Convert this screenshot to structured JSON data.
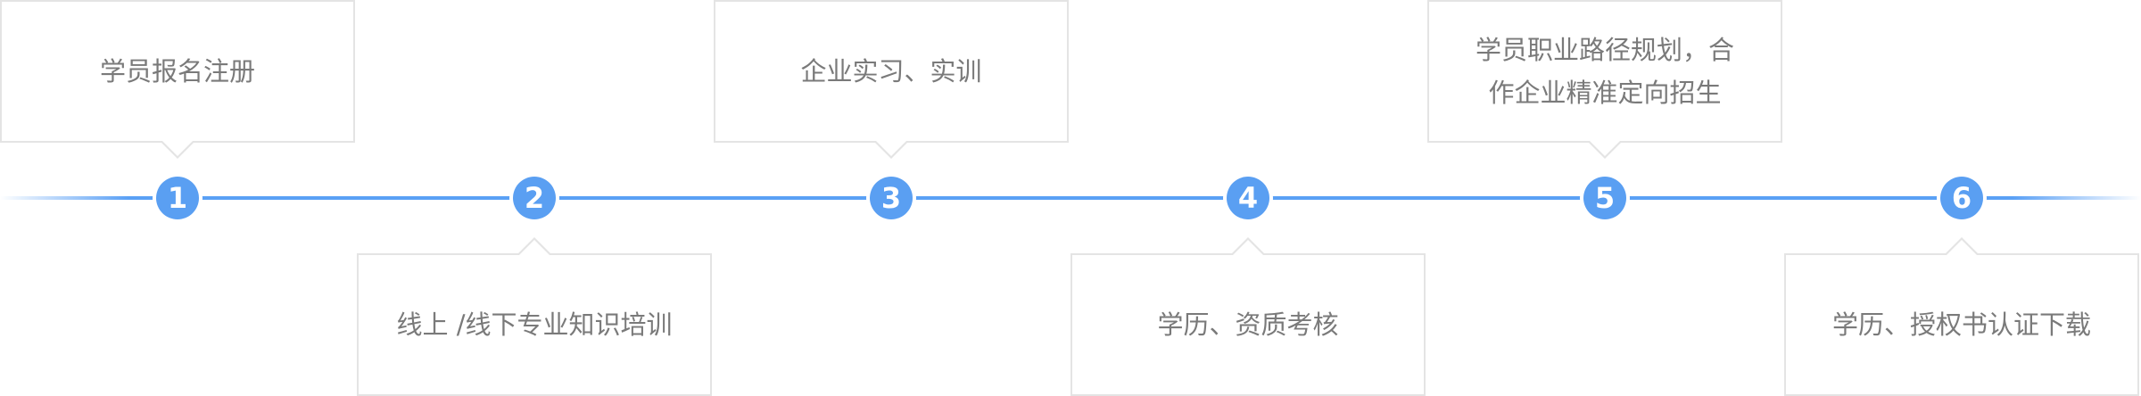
{
  "steps": [
    {
      "number": "1",
      "label": "学员报名注册"
    },
    {
      "number": "2",
      "label": "线上 /线下专业知识培训"
    },
    {
      "number": "3",
      "label": "企业实习、实训"
    },
    {
      "number": "4",
      "label": "学历、资质考核"
    },
    {
      "number": "5",
      "label": "学员职业路径规划，合\n作企业精准定向招生"
    },
    {
      "number": "6",
      "label": "学历、授权书认证下载"
    }
  ],
  "colors": {
    "accent": "#5a9ff2",
    "border": "#e4e4e4",
    "text": "#7a7a7a"
  }
}
